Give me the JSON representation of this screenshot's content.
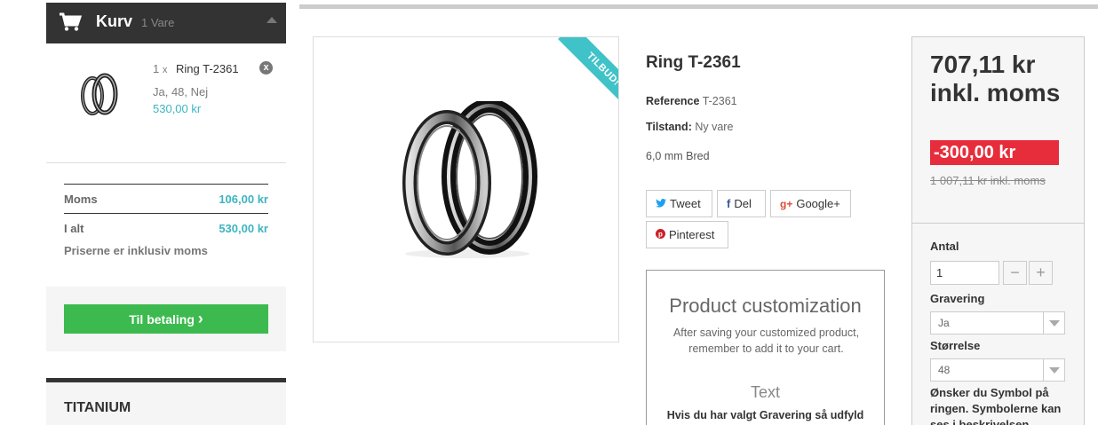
{
  "cart": {
    "title": "Kurv",
    "count": "1 Vare",
    "item": {
      "qty": "1",
      "qty_x": "x",
      "name": "Ring T-2361",
      "attributes": "Ja, 48, Nej",
      "price": "530,00 kr",
      "remove_icon": "x"
    },
    "tax_label": "Moms",
    "tax_value": "106,00 kr",
    "total_label": "I alt",
    "total_value": "530,00 kr",
    "note": "Priserne er inklusiv moms",
    "checkout_label": "Til betaling",
    "checkout_icon": "›"
  },
  "category": {
    "title": "TITANIUM"
  },
  "product": {
    "ribbon": "TILBUD!",
    "title": "Ring T-2361",
    "reference_label": "Reference",
    "reference_value": "T-2361",
    "condition_label": "Tilstand:",
    "condition_value": "Ny vare",
    "description": "6,0 mm Bred"
  },
  "share": {
    "tweet": "Tweet",
    "share": "Del",
    "google": "Google+",
    "pinterest": "Pinterest"
  },
  "customization": {
    "title": "Product customization",
    "subtitle": "After saving your customized product, remember to add it to your cart.",
    "text_label": "Text",
    "field_label": "Hvis du har valgt Gravering så udfyld"
  },
  "price": {
    "current": "707,11 kr inkl. moms",
    "discount": "-300,00 kr",
    "old_amount": "1 007,11 kr",
    "old_suffix": " inkl. moms"
  },
  "options": {
    "quantity_label": "Antal",
    "quantity_value": "1",
    "minus": "−",
    "plus": "+",
    "engraving_label": "Gravering",
    "engraving_value": "Ja",
    "size_label": "Størrelse",
    "size_value": "48",
    "symbol_question": "Ønsker du Symbol på ringen. Symbolerne kan ses i beskrivelsen"
  },
  "colors": {
    "accent": "#3cb5c1",
    "checkout": "#3dba4f",
    "discount": "#e72d3b",
    "ribbon": "#40c3c8",
    "dark": "#333333"
  }
}
